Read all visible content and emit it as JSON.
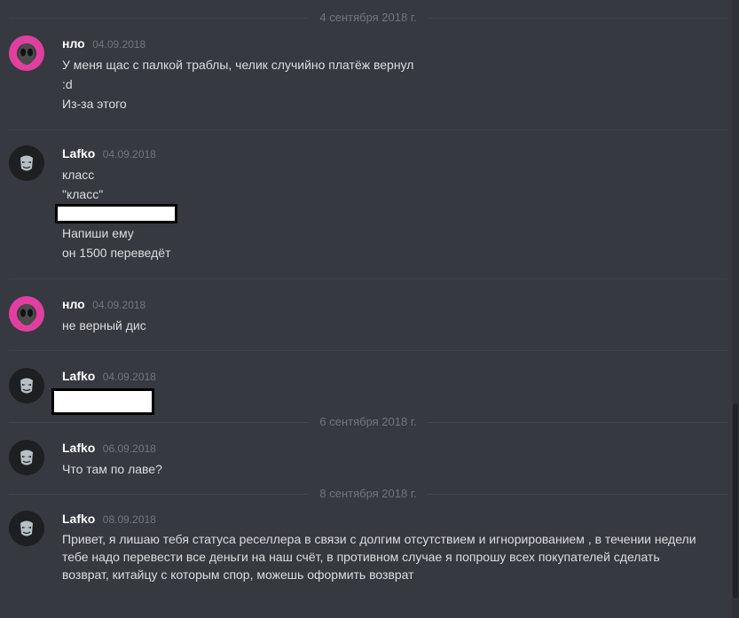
{
  "dividers": [
    "4 сентября 2018 г.",
    "6 сентября 2018 г.",
    "8 сентября 2018 г."
  ],
  "messages": [
    {
      "username": "нло",
      "timestamp": "04.09.2018",
      "avatar": "alien-avatar",
      "lines": [
        "У меня щас с палкой траблы, челик случийно платёж вернул",
        ":d",
        "Из-за этого"
      ]
    },
    {
      "username": "Lafko",
      "timestamp": "04.09.2018",
      "avatar": "mask-avatar",
      "lines": [
        "класс",
        "\"класс\"",
        "Напиши ему",
        "он 1500 переведёт"
      ]
    },
    {
      "username": "нло",
      "timestamp": "04.09.2018",
      "avatar": "alien-avatar",
      "lines": [
        "не верный дис"
      ]
    },
    {
      "username": "Lafko",
      "timestamp": "04.09.2018",
      "avatar": "mask-avatar",
      "lines": []
    },
    {
      "username": "Lafko",
      "timestamp": "06.09.2018",
      "avatar": "mask-avatar",
      "lines": [
        "Что там по лаве?"
      ]
    },
    {
      "username": "Lafko",
      "timestamp": "08.09.2018",
      "avatar": "mask-avatar",
      "lines": [
        "Привет, я лишаю тебя статуса реселлера в связи с долгим отсутствием и игнорированием , в течении недели тебе надо перевести все деньги на наш счёт, в противном случае я попрошу всех покупателей сделать возврат, китайцу с которым спор, можешь оформить возврат"
      ]
    }
  ],
  "colors": {
    "background": "#36393f",
    "text": "#dcddde",
    "username": "#ffffff",
    "muted": "#72767d"
  }
}
